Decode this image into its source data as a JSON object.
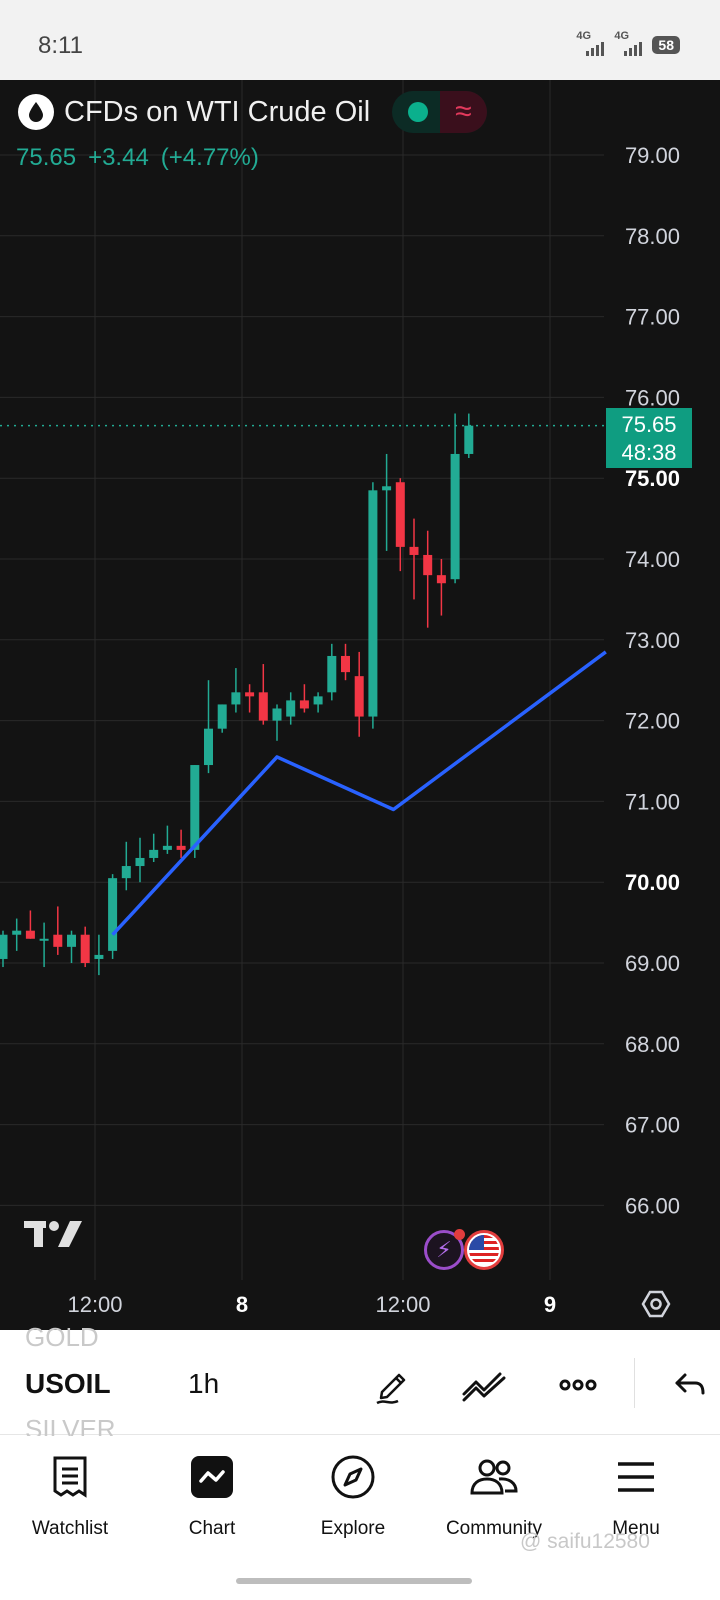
{
  "status_bar": {
    "time": "8:11",
    "net1": "4G",
    "net2": "4G",
    "battery": "58"
  },
  "header": {
    "symbol_name": "CFDs on WTI Crude Oil",
    "last_price": "75.65",
    "change": "+3.44",
    "change_pct": "(+4.77%)",
    "market_status_icons": [
      "market-open-dot-icon",
      "wave-icon"
    ]
  },
  "price_tag": {
    "price": "75.65",
    "countdown": "48:38"
  },
  "colors": {
    "up": "#22ab94",
    "down": "#f23645",
    "indicator_line": "#2962ff",
    "background": "#131313",
    "grid": "#2a2a2a"
  },
  "chart_data": {
    "type": "candlestick",
    "interval": "1h",
    "y_axis_labels": [
      "79.00",
      "78.00",
      "77.00",
      "76.00",
      "75.00",
      "74.00",
      "73.00",
      "72.00",
      "71.00",
      "70.00",
      "69.00",
      "68.00",
      "67.00",
      "66.00"
    ],
    "bold_y_labels": [
      "75.00",
      "70.00"
    ],
    "x_axis_labels": [
      "12:00",
      "8",
      "12:00",
      "9"
    ],
    "bold_x_labels": [
      "8",
      "9"
    ],
    "ylim": [
      65.5,
      79.3
    ],
    "current_price": 75.65,
    "candles": [
      {
        "o": 69.05,
        "h": 69.4,
        "l": 68.95,
        "c": 69.35
      },
      {
        "o": 69.35,
        "h": 69.55,
        "l": 69.15,
        "c": 69.4
      },
      {
        "o": 69.4,
        "h": 69.65,
        "l": 69.3,
        "c": 69.3
      },
      {
        "o": 69.3,
        "h": 69.5,
        "l": 68.95,
        "c": 69.3
      },
      {
        "o": 69.35,
        "h": 69.7,
        "l": 69.1,
        "c": 69.2
      },
      {
        "o": 69.2,
        "h": 69.4,
        "l": 69.0,
        "c": 69.35
      },
      {
        "o": 69.35,
        "h": 69.45,
        "l": 68.95,
        "c": 69.0
      },
      {
        "o": 69.05,
        "h": 69.35,
        "l": 68.85,
        "c": 69.1
      },
      {
        "o": 69.15,
        "h": 70.1,
        "l": 69.05,
        "c": 70.05
      },
      {
        "o": 70.05,
        "h": 70.5,
        "l": 69.9,
        "c": 70.2
      },
      {
        "o": 70.2,
        "h": 70.55,
        "l": 70.0,
        "c": 70.3
      },
      {
        "o": 70.3,
        "h": 70.6,
        "l": 70.25,
        "c": 70.4
      },
      {
        "o": 70.4,
        "h": 70.7,
        "l": 70.35,
        "c": 70.45
      },
      {
        "o": 70.45,
        "h": 70.65,
        "l": 70.3,
        "c": 70.4
      },
      {
        "o": 70.4,
        "h": 71.45,
        "l": 70.3,
        "c": 71.45
      },
      {
        "o": 71.45,
        "h": 72.5,
        "l": 71.35,
        "c": 71.9
      },
      {
        "o": 71.9,
        "h": 72.2,
        "l": 71.85,
        "c": 72.2
      },
      {
        "o": 72.2,
        "h": 72.65,
        "l": 72.1,
        "c": 72.35
      },
      {
        "o": 72.35,
        "h": 72.45,
        "l": 72.1,
        "c": 72.3
      },
      {
        "o": 72.35,
        "h": 72.7,
        "l": 71.95,
        "c": 72.0
      },
      {
        "o": 72.0,
        "h": 72.2,
        "l": 71.75,
        "c": 72.15
      },
      {
        "o": 72.05,
        "h": 72.35,
        "l": 71.95,
        "c": 72.25
      },
      {
        "o": 72.25,
        "h": 72.45,
        "l": 72.1,
        "c": 72.15
      },
      {
        "o": 72.2,
        "h": 72.35,
        "l": 72.1,
        "c": 72.3
      },
      {
        "o": 72.35,
        "h": 72.95,
        "l": 72.25,
        "c": 72.8
      },
      {
        "o": 72.8,
        "h": 72.95,
        "l": 72.5,
        "c": 72.6
      },
      {
        "o": 72.55,
        "h": 72.85,
        "l": 71.8,
        "c": 72.05
      },
      {
        "o": 72.05,
        "h": 74.95,
        "l": 71.9,
        "c": 74.85
      },
      {
        "o": 74.85,
        "h": 75.3,
        "l": 74.1,
        "c": 74.9
      },
      {
        "o": 74.95,
        "h": 75.0,
        "l": 73.85,
        "c": 74.15
      },
      {
        "o": 74.15,
        "h": 74.5,
        "l": 73.5,
        "c": 74.05
      },
      {
        "o": 74.05,
        "h": 74.35,
        "l": 73.15,
        "c": 73.8
      },
      {
        "o": 73.8,
        "h": 74.0,
        "l": 73.3,
        "c": 73.7
      },
      {
        "o": 73.75,
        "h": 75.8,
        "l": 73.7,
        "c": 75.3
      },
      {
        "o": 75.3,
        "h": 75.8,
        "l": 75.25,
        "c": 75.65
      }
    ],
    "indicator_line": [
      {
        "bar": 8,
        "value": 69.35
      },
      {
        "bar": 20,
        "value": 71.55
      },
      {
        "bar": 28.5,
        "value": 70.9
      },
      {
        "bar": 44,
        "value": 72.85
      }
    ]
  },
  "toolbar": {
    "prev_symbol": "GOLD",
    "symbol": "USOIL",
    "next_symbol": "SILVER",
    "interval": "1h",
    "tools": [
      "pencil-icon",
      "indicators-icon",
      "more-icon",
      "undo-icon"
    ]
  },
  "nav": {
    "items": [
      {
        "label": "Watchlist"
      },
      {
        "label": "Chart"
      },
      {
        "label": "Explore"
      },
      {
        "label": "Community"
      },
      {
        "label": "Menu"
      }
    ]
  },
  "watermark": "@ saifu12580"
}
